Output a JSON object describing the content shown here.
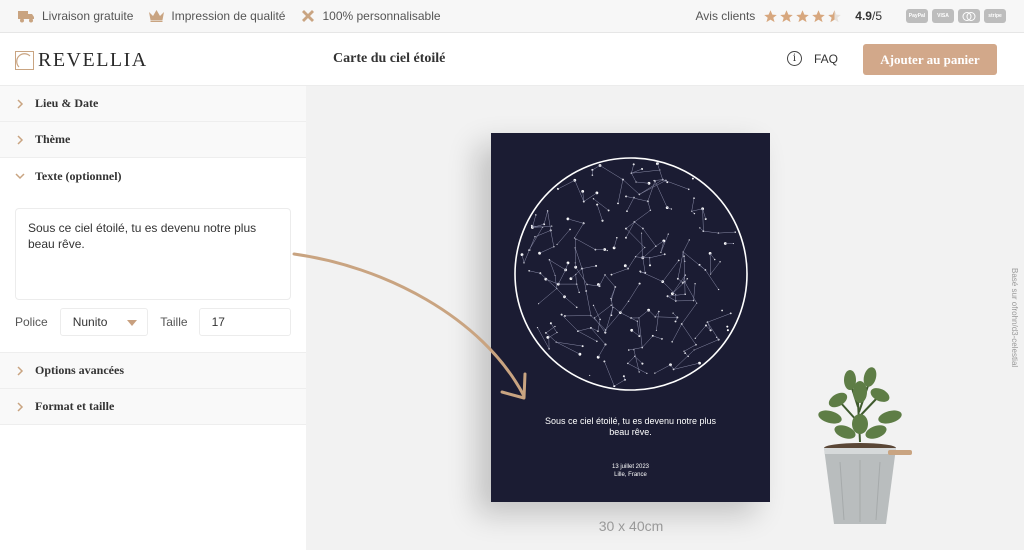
{
  "topbar": {
    "features": [
      {
        "icon": "truck-icon",
        "label": "Livraison gratuite"
      },
      {
        "icon": "crown-icon",
        "label": "Impression de qualité"
      },
      {
        "icon": "tools-icon",
        "label": "100% personnalisable"
      }
    ],
    "reviews_label": "Avis clients",
    "rating": "4.9",
    "rating_max": "/5",
    "stars_count": 4.5,
    "payments": [
      "PayPal",
      "VISA",
      "MC",
      "stripe"
    ],
    "colors": {
      "star": "#d7a77e"
    }
  },
  "header": {
    "logo": "REVELLIA",
    "title": "Carte du ciel étoilé",
    "faq": "FAQ",
    "cart_button": "Ajouter au panier",
    "colors": {
      "accent": "#d2a88a"
    }
  },
  "sidebar": {
    "sections": [
      {
        "label": "Lieu & Date",
        "open": false
      },
      {
        "label": "Thème",
        "open": false
      },
      {
        "label": "Texte (optionnel)",
        "open": true
      },
      {
        "label": "Options avancées",
        "open": false
      },
      {
        "label": "Format et taille",
        "open": false
      }
    ],
    "text_value": "Sous ce ciel étoilé, tu es devenu notre plus beau rêve.",
    "font_label": "Police",
    "font_value": "Nunito",
    "size_label": "Taille",
    "size_value": "17"
  },
  "preview": {
    "poster_text_line1": "Sous ce ciel étoilé, tu es devenu notre plus",
    "poster_text_line2": "beau rêve.",
    "poster_date": "13 juillet 2023",
    "poster_place": "Lille, France",
    "size_caption": "30 x 40cm",
    "credit": "Basé sur ofrohn/d3-celestial",
    "colors": {
      "poster_bg": "#1b1c33",
      "arrow": "#c9a481"
    }
  }
}
